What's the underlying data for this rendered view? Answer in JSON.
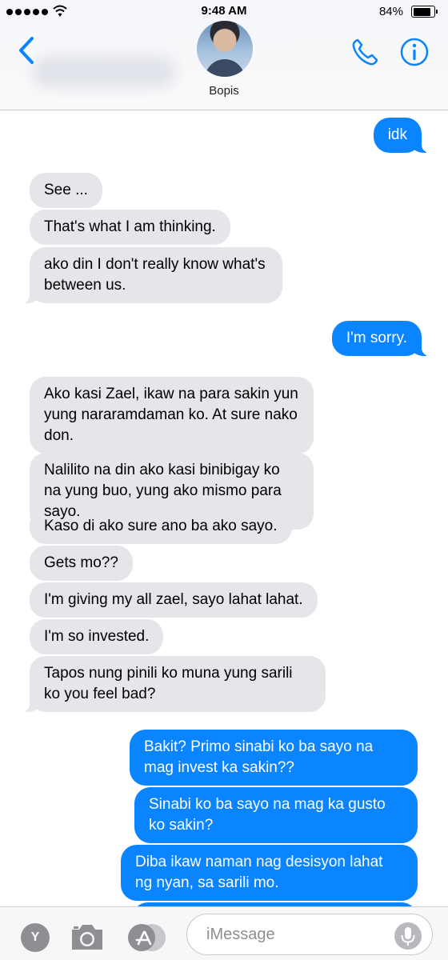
{
  "status_bar": {
    "time": "9:48 AM",
    "battery_percent": "84%",
    "battery_level": 0.84,
    "signal_dots": 5
  },
  "header": {
    "contact_name": "Bopis",
    "back_icon": "chevron-left-icon",
    "call_icon": "phone-icon",
    "info_icon": "info-icon",
    "accent_color": "#0a84ff"
  },
  "messages": [
    {
      "from": "me",
      "text": "idk"
    },
    {
      "from": "them",
      "text": "See ..."
    },
    {
      "from": "them",
      "text": "That's what I am thinking."
    },
    {
      "from": "them",
      "text": "ako din I don't really know what's between us."
    },
    {
      "from": "me",
      "text": "I'm sorry."
    },
    {
      "from": "them",
      "text": "Ako kasi Zael, ikaw na para sakin yun yung nararamdaman ko. At sure nako don."
    },
    {
      "from": "them",
      "text": "Nalilito na din ako kasi binibigay ko na yung buo, yung ako mismo para sayo."
    },
    {
      "from": "them",
      "text": "Kaso di ako sure ano ba ako sayo."
    },
    {
      "from": "them",
      "text": "Gets mo??"
    },
    {
      "from": "them",
      "text": "I'm giving my all zael, sayo lahat lahat."
    },
    {
      "from": "them",
      "text": "I'm so invested."
    },
    {
      "from": "them",
      "text": "Tapos nung pinili ko muna yung sarili ko you feel bad?"
    },
    {
      "from": "me",
      "text": "Bakit? Primo sinabi ko ba sayo na mag invest ka sakin??"
    },
    {
      "from": "me",
      "text": "Sinabi ko ba sayo na mag ka gusto ko sakin?"
    },
    {
      "from": "me",
      "text": "Diba ikaw naman nag desisyon lahat ng nyan, sa sarili mo."
    }
  ],
  "bubble_colors": {
    "incoming": "#e5e5ea",
    "outgoing": "#0a84ff"
  },
  "input_bar": {
    "placeholder": "iMessage",
    "value": "",
    "app_button_letter": "Y",
    "camera_icon": "camera-icon",
    "app_store_icon": "app-store-icon",
    "mic_icon": "microphone-icon"
  }
}
